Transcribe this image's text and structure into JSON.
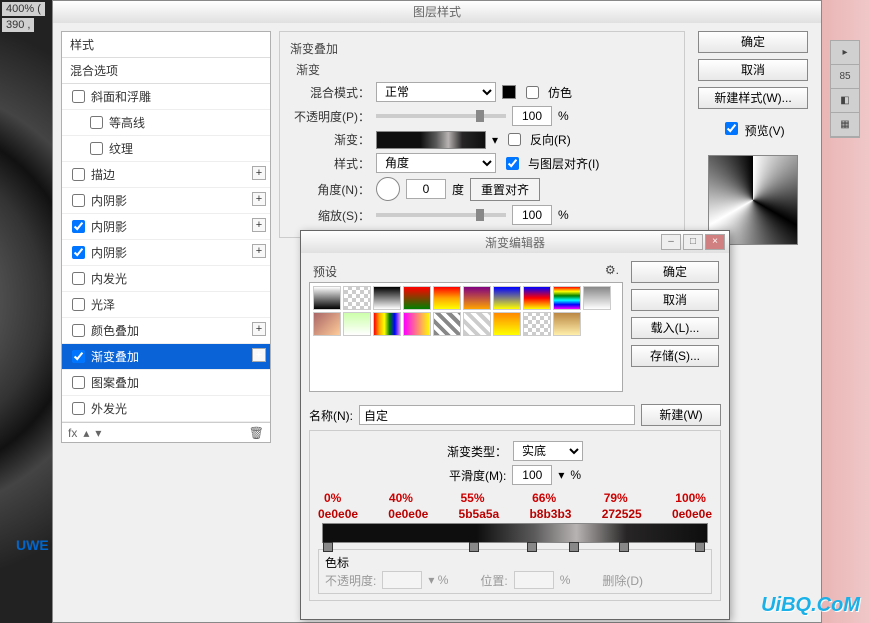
{
  "zoom": "400% (",
  "coord": "390 ,",
  "dialog1": {
    "title": "图层样式",
    "styles_header": "样式",
    "blend_header": "混合选项",
    "items": [
      {
        "label": "斜面和浮雕",
        "checked": false,
        "plus": false,
        "indent": false
      },
      {
        "label": "等高线",
        "checked": false,
        "plus": false,
        "indent": true
      },
      {
        "label": "纹理",
        "checked": false,
        "plus": false,
        "indent": true
      },
      {
        "label": "描边",
        "checked": false,
        "plus": true,
        "indent": false
      },
      {
        "label": "内阴影",
        "checked": false,
        "plus": true,
        "indent": false
      },
      {
        "label": "内阴影",
        "checked": true,
        "plus": true,
        "indent": false
      },
      {
        "label": "内阴影",
        "checked": true,
        "plus": true,
        "indent": false
      },
      {
        "label": "内发光",
        "checked": false,
        "plus": false,
        "indent": false
      },
      {
        "label": "光泽",
        "checked": false,
        "plus": false,
        "indent": false
      },
      {
        "label": "颜色叠加",
        "checked": false,
        "plus": true,
        "indent": false
      },
      {
        "label": "渐变叠加",
        "checked": true,
        "plus": true,
        "indent": false,
        "selected": true
      },
      {
        "label": "图案叠加",
        "checked": false,
        "plus": false,
        "indent": false
      },
      {
        "label": "外发光",
        "checked": false,
        "plus": false,
        "indent": false
      }
    ],
    "footer_fx": "fx",
    "section_title": "渐变叠加",
    "section_sub": "渐变",
    "blend_mode_label": "混合模式：",
    "blend_mode_value": "正常",
    "dither_label": "仿色",
    "opacity_label": "不透明度(P)：",
    "opacity_value": "100",
    "opacity_unit": "%",
    "gradient_label": "渐变：",
    "reverse_label": "反向(R)",
    "style_label": "样式：",
    "style_value": "角度",
    "align_label": "与图层对齐(I)",
    "angle_label": "角度(N)：",
    "angle_value": "0",
    "angle_unit": "度",
    "reset_align": "重置对齐",
    "scale_label": "缩放(S)：",
    "scale_value": "100",
    "scale_unit": "%",
    "ok": "确定",
    "cancel": "取消",
    "new_style": "新建样式(W)...",
    "preview": "预览(V)"
  },
  "dialog2": {
    "title": "渐变编辑器",
    "presets_label": "预设",
    "ok": "确定",
    "cancel": "取消",
    "load": "载入(L)...",
    "save": "存储(S)...",
    "name_label": "名称(N):",
    "name_value": "自定",
    "new_btn": "新建(W)",
    "grad_type_label": "渐变类型：",
    "grad_type_value": "实底",
    "smoothness_label": "平滑度(M):",
    "smoothness_value": "100",
    "smoothness_unit": "%",
    "stop_pcts": [
      "0%",
      "40%",
      "55%",
      "66%",
      "79%",
      "100%"
    ],
    "stop_colors": [
      "0e0e0e",
      "0e0e0e",
      "5b5a5a",
      "b8b3b3",
      "272525",
      "0e0e0e"
    ],
    "stops_title": "色标",
    "stop_opacity_label": "不透明度:",
    "stop_position_label": "位置:",
    "stop_position_unit": "%",
    "stop_delete": "删除(D)"
  },
  "watermark": "UiBQ.CoM",
  "watermark2": "UWE"
}
